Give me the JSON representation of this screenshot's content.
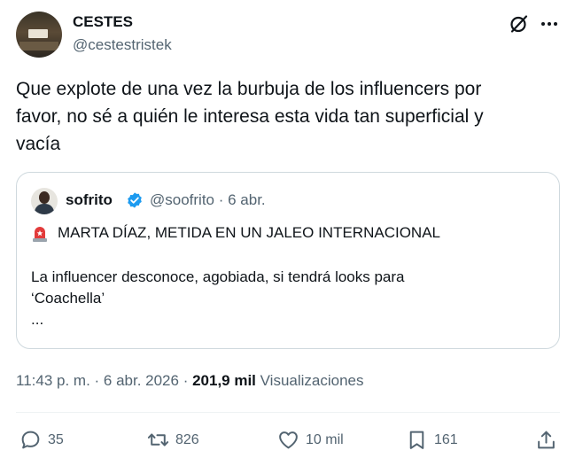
{
  "header": {
    "display_name": "CESTES",
    "handle": "@cestestristek",
    "avatar_icon": "profile-photo",
    "grok_icon": "grok-icon",
    "more_icon": "more-icon"
  },
  "tweet": {
    "text": "Que explote de una vez la burbuja de los influencers por\nfavor, no sé a quién le interesa esta vida tan superficial y\nvacía"
  },
  "quoted_tweet": {
    "display_name": "sofrito",
    "verified_color": "#1d9bf0",
    "handle_date": "@soofrito · 6 abr.",
    "headline": "MARTA DÍAZ, METIDA EN UN JALEO INTERNACIONAL",
    "headline_icon": "siren-icon",
    "body": "La influencer desconoce, agobiada, si tendrá looks para\n‘Coachella’\n..."
  },
  "meta": {
    "time_date": "11:43 p. m. · 6 abr. 2026 · ",
    "views_count": "201,9 mil",
    "views_label": " Visualizaciones"
  },
  "actions": {
    "replies": "35",
    "reposts": "826",
    "likes": "10 mil",
    "bookmarks": "161"
  },
  "colors": {
    "text": "#0f1419",
    "secondary": "#536471",
    "border": "#cfd9de",
    "verified": "#1d9bf0"
  }
}
